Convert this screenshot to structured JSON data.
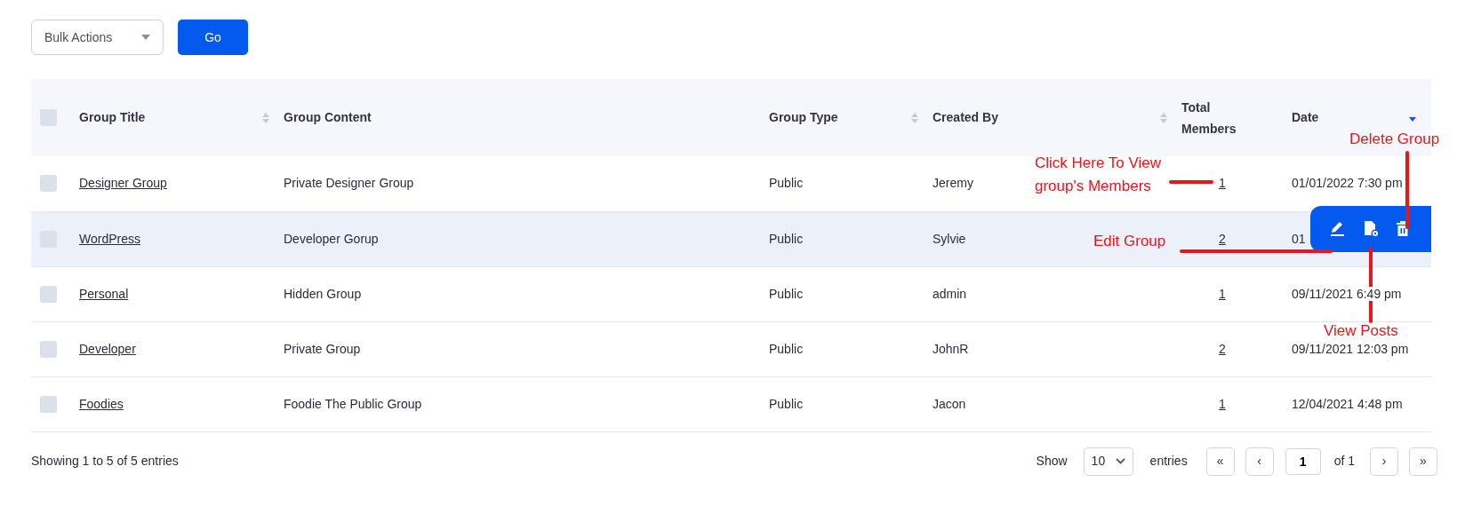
{
  "toolbar": {
    "bulk_actions": {
      "value": "Bulk Actions"
    },
    "go_button": "Go"
  },
  "table": {
    "select_all": {
      "checked": false
    },
    "columns": [
      {
        "label": "Group Title",
        "sortable": true,
        "sorted": false
      },
      {
        "label": "Group Content",
        "sortable": false,
        "sorted": false
      },
      {
        "label": "Group Type",
        "sortable": true,
        "sorted": false
      },
      {
        "label": "Created By",
        "sortable": true,
        "sorted": false
      },
      {
        "label": "Total Members",
        "sortable": false,
        "sorted": false
      },
      {
        "label": "Date",
        "sortable": true,
        "sorted": true
      }
    ],
    "rows": [
      {
        "checked": false,
        "highlighted": false,
        "title": "Designer Group",
        "content": "Private Designer Group",
        "type": "Public",
        "created_by": "Jeremy",
        "members": "1",
        "date": "01/01/2022 7:30 pm"
      },
      {
        "checked": false,
        "highlighted": true,
        "title": "WordPress",
        "content": "Developer Gorup",
        "type": "Public",
        "created_by": "Sylvie",
        "members": "2",
        "date": "01"
      },
      {
        "checked": false,
        "highlighted": false,
        "title": "Personal",
        "content": "Hidden Group",
        "type": "Public",
        "created_by": "admin",
        "members": "1",
        "date": "09/11/2021 6:49 pm"
      },
      {
        "checked": false,
        "highlighted": false,
        "title": "Developer",
        "content": "Private Group",
        "type": "Public",
        "created_by": "JohnR",
        "members": "2",
        "date": "09/11/2021 12:03 pm"
      },
      {
        "checked": false,
        "highlighted": false,
        "title": "Foodies",
        "content": "Foodie The Public Group",
        "type": "Public",
        "created_by": "Jacon",
        "members": "1",
        "date": "12/04/2021 4:48 pm"
      }
    ]
  },
  "row_actions": [
    {
      "kind": "edit"
    },
    {
      "kind": "view-posts"
    },
    {
      "kind": "delete"
    }
  ],
  "annotations": [
    {
      "kind": "members",
      "text": "Click Here To View group's Members"
    },
    {
      "kind": "edit",
      "text": "Edit Group"
    },
    {
      "kind": "delete",
      "text": "Delete Group"
    },
    {
      "kind": "posts",
      "text": "View Posts"
    }
  ],
  "footer": {
    "info": "Showing 1 to 5 of 5 entries",
    "show_label": "Show",
    "page_size": "10",
    "entries_label": "entries",
    "first": "«",
    "prev": "‹",
    "page": "1",
    "of_pages": "of 1",
    "next": "›",
    "last": "»"
  }
}
